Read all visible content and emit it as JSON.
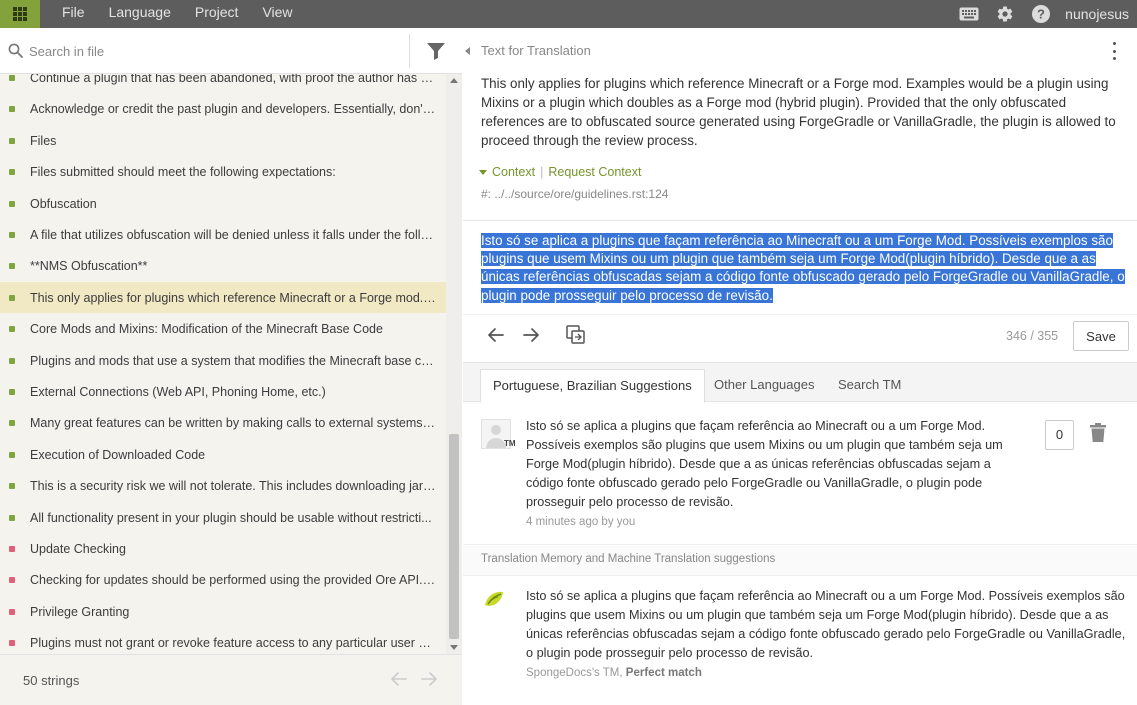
{
  "topbar": {
    "menu": [
      "File",
      "Language",
      "Project",
      "View"
    ],
    "username": "nunojesus",
    "icons": [
      "apps-grid-icon",
      "keyboard-icon",
      "gear-icon",
      "help-icon"
    ]
  },
  "left": {
    "search_placeholder": "Search in file",
    "strings_count": "50 strings",
    "items": [
      {
        "text": "Continue a plugin that has been abandoned, with proof the author has n...",
        "status": "ok"
      },
      {
        "text": "Acknowledge or credit the past plugin and developers. Essentially, don't ...",
        "status": "ok"
      },
      {
        "text": "Files",
        "status": "ok"
      },
      {
        "text": "Files submitted should meet the following expectations:",
        "status": "ok"
      },
      {
        "text": "Obfuscation",
        "status": "ok"
      },
      {
        "text": "A file that utilizes obfuscation will be denied unless it falls under the follo...",
        "status": "ok"
      },
      {
        "text": "**NMS Obfuscation**",
        "status": "ok"
      },
      {
        "text": "This only applies for plugins which reference Minecraft or a Forge mod. ...",
        "status": "ok"
      },
      {
        "text": "Core Mods and Mixins: Modification of the Minecraft Base Code",
        "status": "ok"
      },
      {
        "text": "Plugins and mods that use a system that modifies the Minecraft base co...",
        "status": "ok"
      },
      {
        "text": "External Connections (Web API, Phoning Home, etc.)",
        "status": "ok"
      },
      {
        "text": "Many great features can be written by making calls to external systems. ...",
        "status": "ok"
      },
      {
        "text": "Execution of Downloaded Code",
        "status": "ok"
      },
      {
        "text": "This is a security risk we will not tolerate. This includes downloading jar ...",
        "status": "ok"
      },
      {
        "text": "All functionality present in your plugin should be usable without restricti...",
        "status": "ok"
      },
      {
        "text": "Update Checking",
        "status": "bad"
      },
      {
        "text": "Checking for updates should be performed using the provided Ore API. ...",
        "status": "bad"
      },
      {
        "text": "Privilege Granting",
        "status": "bad"
      },
      {
        "text": "Plugins must not grant or revoke feature access to any particular user or...",
        "status": "bad"
      }
    ]
  },
  "right": {
    "title": "Text for Translation",
    "source_text": "This only applies for plugins which reference Minecraft or a Forge mod. Examples would be a plugin using Mixins or a plugin which doubles as a Forge mod (hybrid plugin). Provided that the only obfuscated references are to obfuscated source generated using ForgeGradle or VanillaGradle, the plugin is allowed to proceed through the review process.",
    "context_label": "Context",
    "request_context_label": "Request Context",
    "context_path": "#: ../../source/ore/guidelines.rst:124",
    "translation": "Isto só se aplica a plugins que façam referência ao Minecraft ou a um Forge Mod. Possíveis exemplos são plugins que usem Mixins ou um plugin que também seja um Forge Mod(plugin híbrido). Desde que a as únicas referências obfuscadas sejam a código fonte obfuscado gerado pelo ForgeGradle ou VanillaGradle, o plugin pode prosseguir pelo processo de revisão.",
    "progress": "346 / 355",
    "save_label": "Save",
    "tabs": [
      "Portuguese, Brazilian Suggestions",
      "Other Languages",
      "Search TM"
    ],
    "suggestion": {
      "text": "Isto só se aplica a plugins que façam referência ao Minecraft ou a um Forge Mod. Possíveis exemplos são plugins que usem Mixins ou um plugin que também seja um Forge Mod(plugin híbrido). Desde que a as únicas referências obfuscadas sejam a código fonte obfuscado gerado pelo ForgeGradle ou VanillaGradle, o plugin pode prosseguir pelo processo de revisão.",
      "meta": "4 minutes ago by you",
      "votes": "0",
      "badge": "TM"
    },
    "tm_header": "Translation Memory and Machine Translation suggestions",
    "tm_suggestion": {
      "text": "Isto só se aplica a plugins que façam referência ao Minecraft ou a um Forge Mod. Possíveis exemplos são plugins que usem Mixins ou um plugin que também seja um Forge Mod(plugin híbrido). Desde que a as únicas referências obfuscadas sejam a código fonte obfuscado gerado pelo ForgeGradle ou VanillaGradle, o plugin pode prosseguir pelo processo de revisão.",
      "source": "SpongeDocs's TM,",
      "match": "Perfect match"
    }
  },
  "colors": {
    "accent_green": "#84a23b",
    "topbar": "#5d5d5d",
    "selection": "#3875d7",
    "active_row": "#f1e8c4",
    "status_ok": "#7ea53e",
    "status_bad": "#e0607a"
  }
}
